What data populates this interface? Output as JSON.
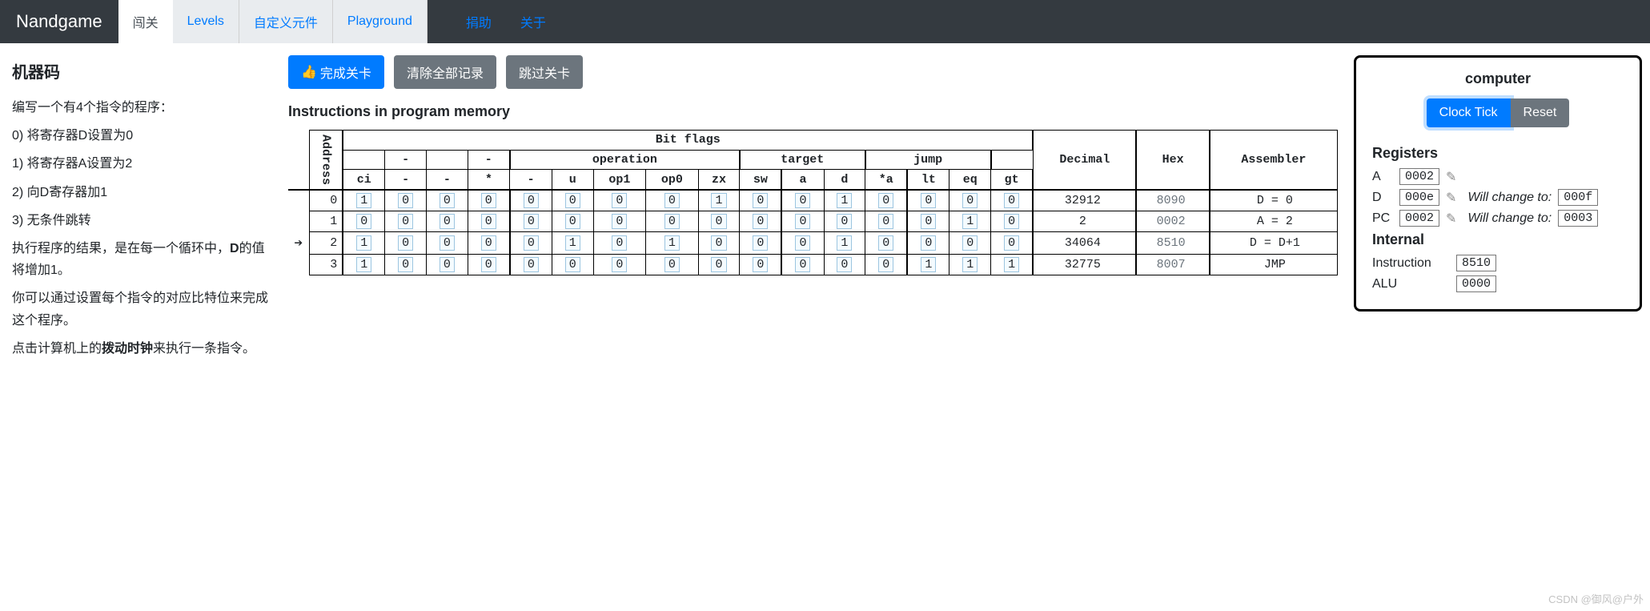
{
  "brand": "Nandgame",
  "nav": {
    "tabs": [
      "闯关",
      "Levels",
      "自定义元件",
      "Playground"
    ],
    "activeTab": 0,
    "links": [
      "捐助",
      "关于"
    ]
  },
  "buttons": {
    "complete": "完成关卡",
    "clear": "清除全部记录",
    "skip": "跳过关卡"
  },
  "left": {
    "title": "机器码",
    "intro": "编写一个有4个指令的程序：",
    "steps": [
      "0) 将寄存器D设置为0",
      "1) 将寄存器A设置为2",
      "2) 向D寄存器加1",
      "3) 无条件跳转"
    ],
    "result_a": "执行程序的结果，是在每一个循环中，",
    "result_b_strong": "D",
    "result_b_rest": "的值将增加1。",
    "hint1": "你可以通过设置每个指令的对应比特位来完成这个程序。",
    "hint2_a": "点击计算机上的",
    "hint2_strong": "拨动时钟",
    "hint2_b": "来执行一条指令。"
  },
  "memory": {
    "heading": "Instructions in program memory",
    "group_labels": {
      "bitflags": "Bit flags",
      "operation": "operation",
      "target": "target",
      "jump": "jump"
    },
    "col_headers": {
      "address": "Address",
      "ci": "ci",
      "dash": "-",
      "star": "*",
      "u": "u",
      "op1": "op1",
      "op0": "op0",
      "zx": "zx",
      "sw": "sw",
      "a": "a",
      "d": "d",
      "sa": "*a",
      "lt": "lt",
      "eq": "eq",
      "gt": "gt",
      "decimal": "Decimal",
      "hex": "Hex",
      "asm": "Assembler"
    },
    "rows": [
      {
        "addr": 0,
        "arrow": false,
        "bits": [
          "1",
          "0",
          "0",
          "0",
          "0",
          "0",
          "0",
          "0",
          "1",
          "0",
          "0",
          "1",
          "0",
          "0",
          "0",
          "0"
        ],
        "dec": "32912",
        "hex": "8090",
        "asm": "D = 0"
      },
      {
        "addr": 1,
        "arrow": false,
        "bits": [
          "0",
          "0",
          "0",
          "0",
          "0",
          "0",
          "0",
          "0",
          "0",
          "0",
          "0",
          "0",
          "0",
          "0",
          "1",
          "0"
        ],
        "dec": "2",
        "hex": "0002",
        "asm": "A = 2"
      },
      {
        "addr": 2,
        "arrow": true,
        "bits": [
          "1",
          "0",
          "0",
          "0",
          "0",
          "1",
          "0",
          "1",
          "0",
          "0",
          "0",
          "1",
          "0",
          "0",
          "0",
          "0"
        ],
        "dec": "34064",
        "hex": "8510",
        "asm": "D = D+1"
      },
      {
        "addr": 3,
        "arrow": false,
        "bits": [
          "1",
          "0",
          "0",
          "0",
          "0",
          "0",
          "0",
          "0",
          "0",
          "0",
          "0",
          "0",
          "0",
          "1",
          "1",
          "1"
        ],
        "dec": "32775",
        "hex": "8007",
        "asm": "JMP"
      }
    ]
  },
  "computer": {
    "title": "computer",
    "clock": "Clock Tick",
    "reset": "Reset",
    "registers_title": "Registers",
    "regs": [
      {
        "name": "A",
        "val": "0002",
        "will": ""
      },
      {
        "name": "D",
        "val": "000e",
        "will": "000f"
      },
      {
        "name": "PC",
        "val": "0002",
        "will": "0003"
      }
    ],
    "will_label": "Will change to:",
    "internal_title": "Internal",
    "internal": [
      {
        "name": "Instruction",
        "val": "8510"
      },
      {
        "name": "ALU",
        "val": "0000"
      }
    ]
  },
  "watermark": "CSDN @御风@户外"
}
